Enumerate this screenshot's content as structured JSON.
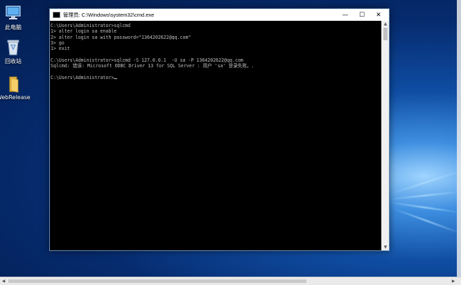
{
  "desktop": {
    "icons": [
      {
        "label": "此电脑",
        "icon": "computer-icon"
      },
      {
        "label": "回收站",
        "icon": "recycle-bin-icon"
      },
      {
        "label": "WebRelease",
        "icon": "folder-icon"
      }
    ]
  },
  "window": {
    "title": "管理员: C:\\Windows\\system32\\cmd.exe",
    "controls": {
      "minimize": "—",
      "maximize": "☐",
      "close": "✕"
    }
  },
  "console": {
    "lines": [
      "C:\\Users\\Administrator>sqlcmd",
      "1> alter login sa enable",
      "2> alter login sa with password=\"1364202622@qq.com\"",
      "3> go",
      "1> exit",
      "",
      "C:\\Users\\Administrator>sqlcmd -S 127.0.0.1  -U sa -P 1364202622@qq.com",
      "Sqlcmd: 错误: Microsoft ODBC Driver 13 for SQL Server : 用户 'sa' 登录失败。.",
      "",
      "C:\\Users\\Administrator>"
    ]
  },
  "colors": {
    "console_bg": "#000000",
    "console_fg": "#c0c0c0",
    "desktop_accent": "#0f4da3"
  }
}
